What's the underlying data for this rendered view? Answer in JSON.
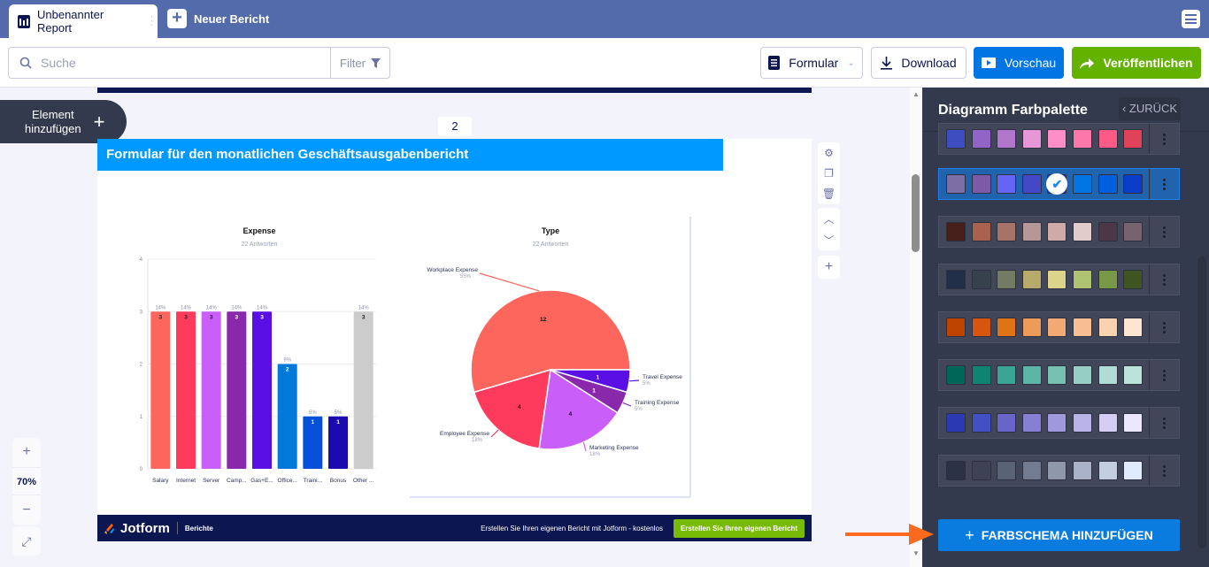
{
  "tabs": {
    "active": "Unbenannter Report",
    "new": "Neuer Bericht"
  },
  "toolbar": {
    "search_placeholder": "Suche",
    "filter": "Filter",
    "formular": "Formular",
    "download": "Download",
    "preview": "Vorschau",
    "publish": "Veröffentlichen"
  },
  "canvas": {
    "add_element_line1": "Element",
    "add_element_line2": "hinzufügen",
    "page_number": "2",
    "zoom": "70%",
    "report_title": "Formular für den monatlichen Geschäftsausgabenbericht",
    "footer": {
      "brand": "Jotform",
      "section": "Berichte",
      "cta_text": "Erstellen Sie Ihren eigenen Bericht mit Jotform - kostenlos",
      "cta_button": "Erstellen Sie Ihren eigenen Bericht"
    }
  },
  "panel": {
    "title": "Diagramm Farbpalette",
    "back": "ZURÜCK",
    "add_scheme": "FARBSCHEMA HINZUFÜGEN",
    "palettes": [
      {
        "selected": false,
        "colors": [
          "#3e4ec0",
          "#9264c8",
          "#b276cc",
          "#e796d8",
          "#fd8ec8",
          "#fd78a8",
          "#fd5a88",
          "#e0425a"
        ]
      },
      {
        "selected": true,
        "colors": [
          "#7b6fa6",
          "#7d5aa6",
          "#6565f5",
          "#4348c8",
          "#1a3cd8",
          "#0075e3",
          "#005fdf",
          "#0a3ec8"
        ]
      },
      {
        "selected": false,
        "colors": [
          "#461e1a",
          "#a8624d",
          "#a57467",
          "#b59895",
          "#cfaaa6",
          "#e1cccb",
          "#4a3848",
          "#77636f"
        ]
      },
      {
        "selected": false,
        "colors": [
          "#213048",
          "#36414d",
          "#737b62",
          "#b8aa6a",
          "#ddd48c",
          "#aec472",
          "#7a9948",
          "#3f5420"
        ]
      },
      {
        "selected": false,
        "colors": [
          "#bc4400",
          "#d6560e",
          "#e07218",
          "#ee9a58",
          "#f2aa74",
          "#f6be92",
          "#f9d2b0",
          "#fde5d2"
        ]
      },
      {
        "selected": false,
        "colors": [
          "#006658",
          "#0e8572",
          "#3aa594",
          "#5cb5a6",
          "#76c0b2",
          "#96cdc4",
          "#b0dbd6",
          "#bce2dc"
        ]
      },
      {
        "selected": false,
        "colors": [
          "#2a3ab0",
          "#4150c2",
          "#6864c8",
          "#8680d4",
          "#9e98dc",
          "#b9b2e8",
          "#d3cef2",
          "#ece8fc"
        ]
      },
      {
        "selected": false,
        "colors": [
          "#2b3245",
          "#3d4355",
          "#5a6275",
          "#737b90",
          "#8f97ab",
          "#a8b1c6",
          "#c3cee0",
          "#e0ecfd"
        ]
      }
    ]
  },
  "chart_data": [
    {
      "type": "bar",
      "title": "Expense",
      "subtitle": "22 Antworten",
      "categories": [
        "Salary",
        "Internet",
        "Server",
        "Camp...",
        "Gas+E...",
        "Office...",
        "Traini...",
        "Bonus",
        "Other ..."
      ],
      "values": [
        3,
        3,
        3,
        3,
        3,
        2,
        1,
        1,
        3
      ],
      "percent_labels": [
        "14%",
        "14%",
        "14%",
        "14%",
        "14%",
        "9%",
        "5%",
        "5%",
        "14%"
      ],
      "colors": [
        "#fd665d",
        "#fe3b5d",
        "#c95ef9",
        "#8a28ab",
        "#5a10e5",
        "#0179da",
        "#0650da",
        "#1a0ab0",
        "#cccccc"
      ],
      "yticks": [
        0,
        1,
        2,
        3,
        4
      ],
      "ylim": [
        0,
        4
      ],
      "grid": true
    },
    {
      "type": "pie",
      "title": "Type",
      "subtitle": "22 Antworten",
      "labels": [
        "Workplace Expense",
        "Employee Expense",
        "Marketing Expense",
        "Training Expense",
        "Travel Expense"
      ],
      "values": [
        12,
        4,
        4,
        1,
        1
      ],
      "percent_labels": [
        "55%",
        "18%",
        "18%",
        "5%",
        "5%"
      ],
      "colors": [
        "#fd665d",
        "#fe3b5d",
        "#c95ef9",
        "#8a28ab",
        "#5a10e5"
      ]
    }
  ]
}
